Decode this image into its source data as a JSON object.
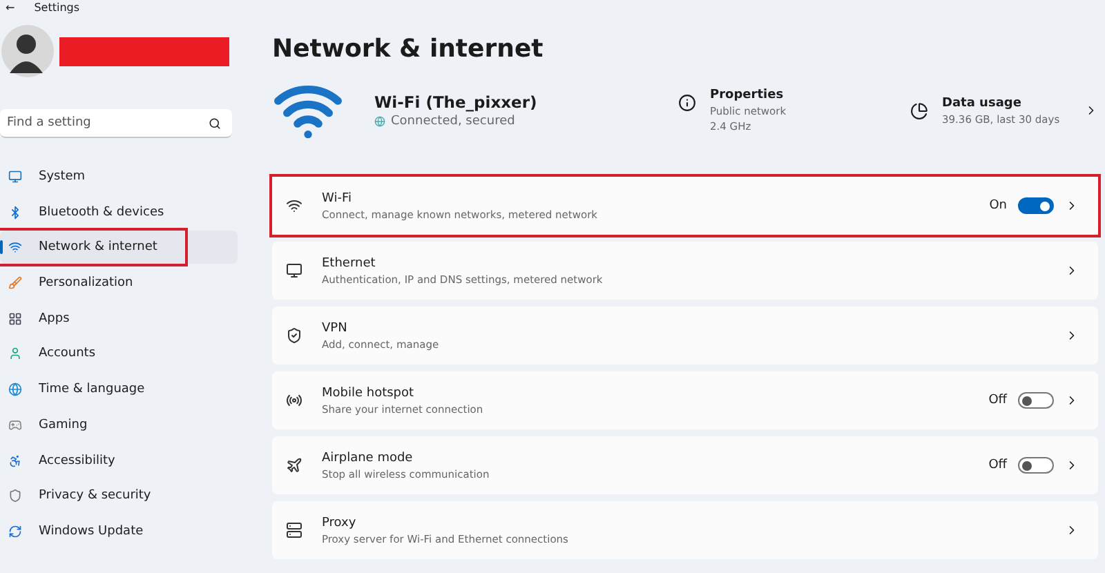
{
  "window": {
    "title": "Settings",
    "back": "←"
  },
  "search": {
    "placeholder": "Find a setting"
  },
  "nav": [
    {
      "label": "System",
      "selected": false,
      "highlighted": false
    },
    {
      "label": "Bluetooth & devices",
      "selected": false,
      "highlighted": false
    },
    {
      "label": "Network & internet",
      "selected": true,
      "highlighted": true
    },
    {
      "label": "Personalization",
      "selected": false,
      "highlighted": false
    },
    {
      "label": "Apps",
      "selected": false,
      "highlighted": false
    },
    {
      "label": "Accounts",
      "selected": false,
      "highlighted": false
    },
    {
      "label": "Time & language",
      "selected": false,
      "highlighted": false
    },
    {
      "label": "Gaming",
      "selected": false,
      "highlighted": false
    },
    {
      "label": "Accessibility",
      "selected": false,
      "highlighted": false
    },
    {
      "label": "Privacy & security",
      "selected": false,
      "highlighted": false
    },
    {
      "label": "Windows Update",
      "selected": false,
      "highlighted": false
    }
  ],
  "page_title": "Network & internet",
  "connection": {
    "name": "Wi-Fi (The_pixxer)",
    "status": "Connected, secured"
  },
  "properties": {
    "title": "Properties",
    "lines": [
      "Public network",
      "2.4 GHz"
    ]
  },
  "data_usage": {
    "title": "Data usage",
    "detail": "39.36 GB, last 30 days"
  },
  "settings": [
    {
      "kind": "toggle",
      "title": "Wi-Fi",
      "description": "Connect, manage known networks, metered network",
      "state": "On",
      "on": true,
      "highlighted": true
    },
    {
      "kind": "link",
      "title": "Ethernet",
      "description": "Authentication, IP and DNS settings, metered network",
      "highlighted": false
    },
    {
      "kind": "link",
      "title": "VPN",
      "description": "Add, connect, manage",
      "highlighted": false
    },
    {
      "kind": "toggle",
      "title": "Mobile hotspot",
      "description": "Share your internet connection",
      "state": "Off",
      "on": false,
      "highlighted": false
    },
    {
      "kind": "toggle",
      "title": "Airplane mode",
      "description": "Stop all wireless communication",
      "state": "Off",
      "on": false,
      "highlighted": false
    },
    {
      "kind": "link",
      "title": "Proxy",
      "description": "Proxy server for Wi-Fi and Ethernet connections",
      "highlighted": false
    }
  ]
}
